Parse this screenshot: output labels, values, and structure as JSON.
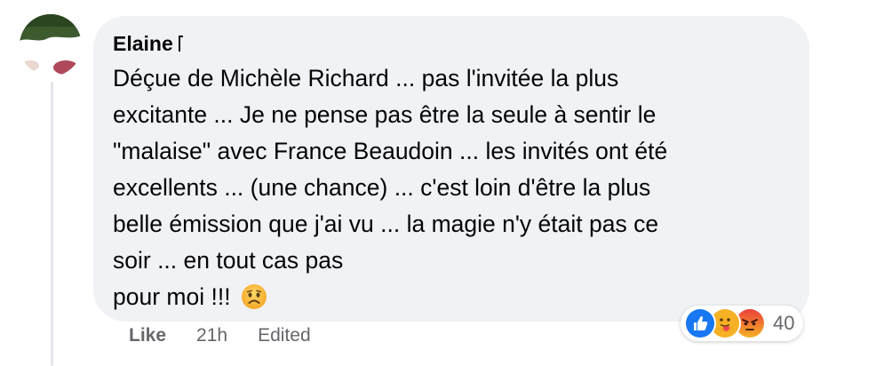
{
  "comment": {
    "author": "Elaine",
    "lines": [
      "Déçue de Michèle Richard ... pas l'invitée la plus",
      "excitante ... Je ne pense pas être la seule à sentir le",
      "\"malaise\" avec France Beaudoin ... les invités ont été",
      "excellents ... (une chance) ... c'est loin d'être la plus",
      "belle émission que j'ai vu ... la magie n'y était pas ce",
      "soir ... en tout cas pas",
      "pour moi !!!"
    ]
  },
  "reactions": {
    "icons": [
      "like-reaction-icon",
      "care-reaction-icon",
      "angry-reaction-icon"
    ],
    "count": "40",
    "colors": {
      "like": "#1877f2",
      "care": "#f7b125",
      "angry": "#e9710f"
    }
  },
  "actions": {
    "like_label": "Like",
    "time": "21h",
    "edited_label": "Edited"
  },
  "colors": {
    "bubble": "#f0f2f5",
    "text": "#050505",
    "secondary": "#65676b",
    "thread_line": "#e4e6eb"
  }
}
